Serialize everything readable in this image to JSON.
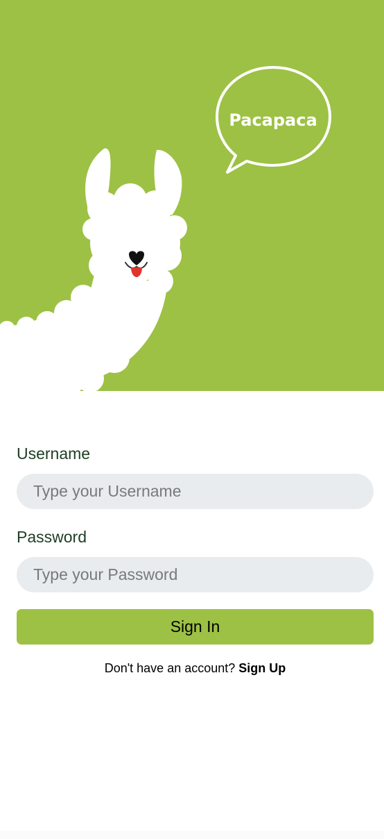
{
  "hero": {
    "bubble_text": "Pacapaca",
    "background_color": "#9dc144",
    "illustration": "alpaca-mascot"
  },
  "form": {
    "username_label": "Username",
    "username_placeholder": "Type your Username",
    "username_value": "",
    "password_label": "Password",
    "password_placeholder": "Type your Password",
    "password_value": "",
    "signin_label": "Sign In",
    "signup_prompt": "Don't have an account?",
    "signup_link": "Sign Up"
  },
  "colors": {
    "accent": "#9dc144",
    "label_text": "#1e3d23",
    "input_bg": "#e9ecee"
  }
}
